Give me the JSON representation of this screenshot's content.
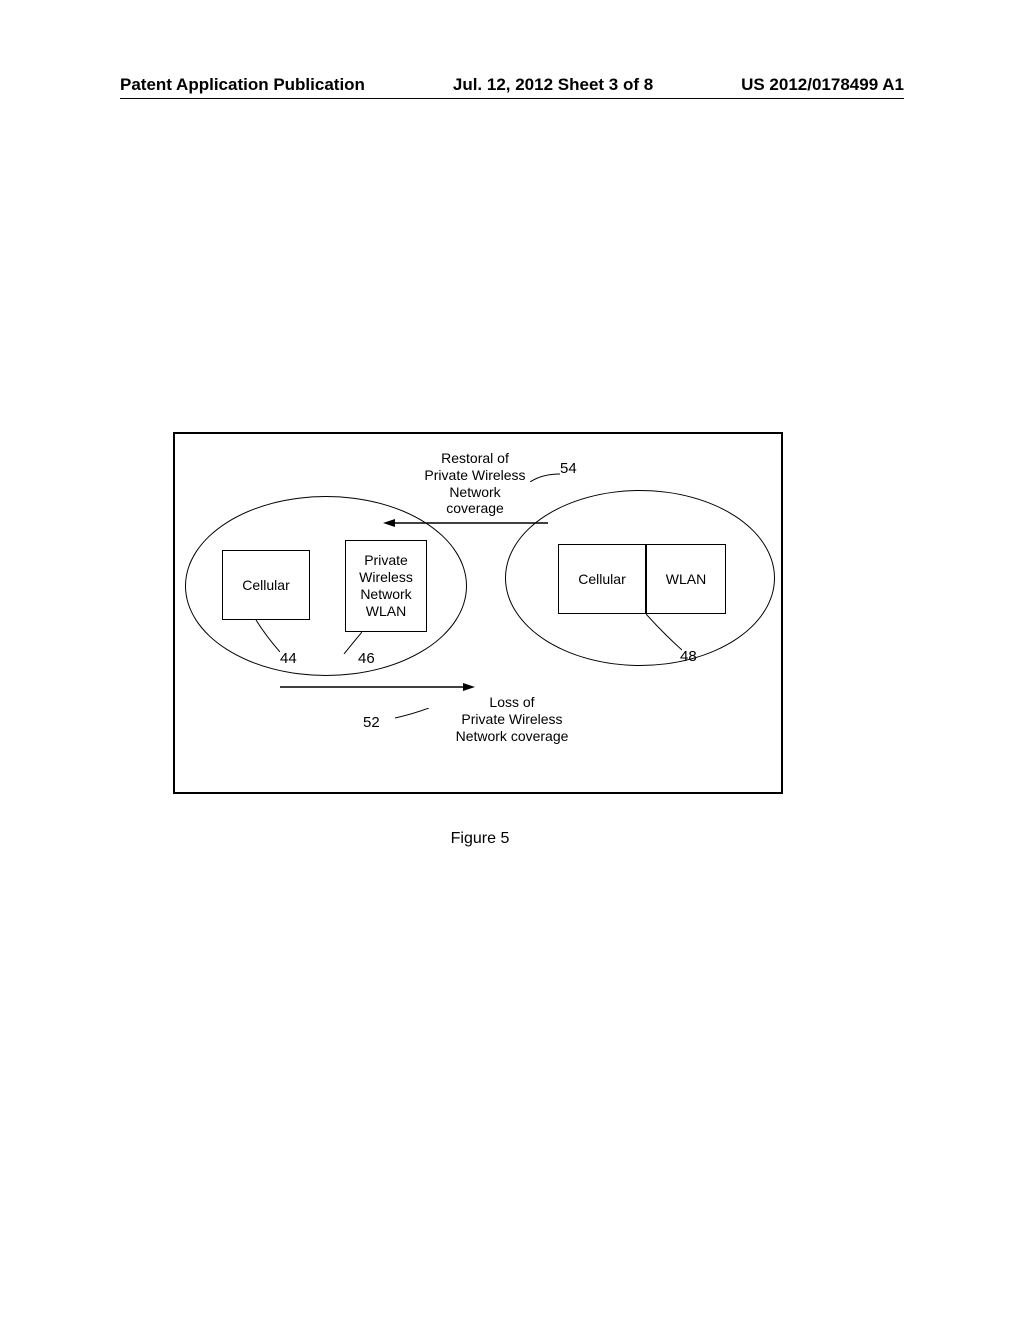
{
  "header": {
    "left": "Patent Application Publication",
    "center": "Jul. 12, 2012  Sheet 3 of 8",
    "right": "US 2012/0178499 A1"
  },
  "diagram": {
    "restoral_label": "Restoral of\nPrivate Wireless\nNetwork\ncoverage",
    "ref_54": "54",
    "left_ellipse": {
      "cellular": "Cellular",
      "pwn": "Private\nWireless\nNetwork\nWLAN"
    },
    "right_ellipse": {
      "cellular": "Cellular",
      "wlan": "WLAN"
    },
    "ref_44": "44",
    "ref_46": "46",
    "ref_48": "48",
    "ref_52": "52",
    "loss_label": "Loss of\nPrivate Wireless\nNetwork coverage"
  },
  "figure_caption": "Figure 5"
}
